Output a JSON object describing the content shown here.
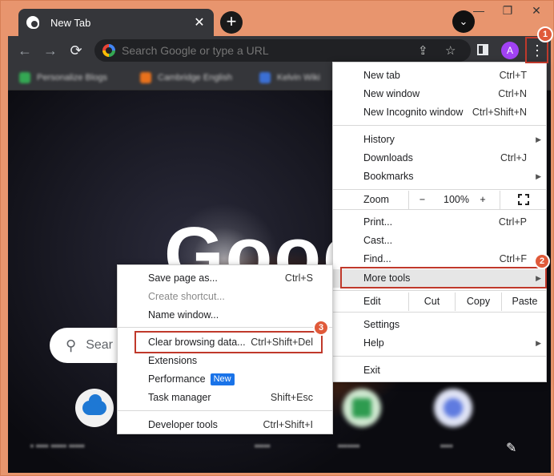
{
  "tab": {
    "title": "New Tab",
    "close": "✕"
  },
  "newtab": "+",
  "window_controls": {
    "minimize": "—",
    "maximize": "❐",
    "close": "✕"
  },
  "toolbar": {
    "back": "←",
    "forward": "→",
    "reload": "⟳",
    "omnibox_placeholder": "Search Google or type a URL",
    "avatar": "A",
    "kebab": "⋮"
  },
  "bookmarks": [
    "Personalize Blogs",
    "Cambridge English",
    "Kelvin Wiki"
  ],
  "page": {
    "logo_text": "Goog",
    "search_placeholder": "Sear"
  },
  "main_menu": {
    "items": {
      "new_tab": {
        "label": "New tab",
        "shortcut": "Ctrl+T"
      },
      "new_window": {
        "label": "New window",
        "shortcut": "Ctrl+N"
      },
      "new_incognito": {
        "label": "New Incognito window",
        "shortcut": "Ctrl+Shift+N"
      },
      "history": {
        "label": "History"
      },
      "downloads": {
        "label": "Downloads",
        "shortcut": "Ctrl+J"
      },
      "bookmarks": {
        "label": "Bookmarks"
      },
      "zoom": {
        "label": "Zoom",
        "minus": "−",
        "value": "100%",
        "plus": "+"
      },
      "print": {
        "label": "Print...",
        "shortcut": "Ctrl+P"
      },
      "cast": {
        "label": "Cast..."
      },
      "find": {
        "label": "Find...",
        "shortcut": "Ctrl+F"
      },
      "more_tools": {
        "label": "More tools"
      },
      "edit": {
        "label": "Edit",
        "cut": "Cut",
        "copy": "Copy",
        "paste": "Paste"
      },
      "settings": {
        "label": "Settings"
      },
      "help": {
        "label": "Help"
      },
      "exit": {
        "label": "Exit"
      }
    }
  },
  "submenu": {
    "save_page": {
      "label": "Save page as...",
      "shortcut": "Ctrl+S"
    },
    "create_shortcut": {
      "label": "Create shortcut..."
    },
    "name_window": {
      "label": "Name window..."
    },
    "clear_browsing": {
      "label": "Clear browsing data...",
      "shortcut": "Ctrl+Shift+Del"
    },
    "extensions": {
      "label": "Extensions"
    },
    "performance": {
      "label": "Performance",
      "badge": "New"
    },
    "task_manager": {
      "label": "Task manager",
      "shortcut": "Shift+Esc"
    },
    "developer_tools": {
      "label": "Developer tools",
      "shortcut": "Ctrl+Shift+I"
    }
  },
  "steps": [
    "1",
    "2",
    "3"
  ],
  "colors": {
    "highlight": "#c0392b",
    "step_badge": "#e05a3a",
    "new_badge": "#1a73e8"
  }
}
